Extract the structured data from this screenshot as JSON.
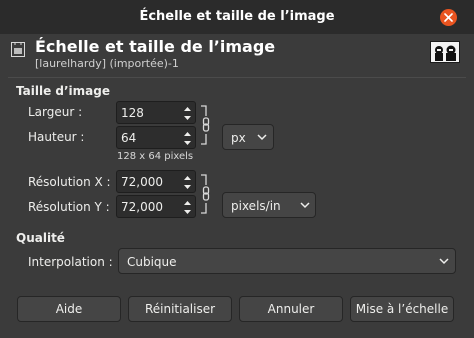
{
  "window": {
    "title": "Échelle et taille de l’image"
  },
  "header": {
    "title": "Échelle et taille de l’image",
    "subtitle": "[laurelhardy] (importée)-1",
    "icon": "scale-image-icon",
    "thumbnail": "image-thumbnail"
  },
  "image_size": {
    "section_label": "Taille d’image",
    "width_label": "Largeur :",
    "width_value": "128",
    "height_label": "Hauteur :",
    "height_value": "64",
    "unit": "px",
    "pixel_info": "128 x 64 pixels",
    "xres_label": "Résolution X :",
    "xres_value": "72,000",
    "yres_label": "Résolution Y :",
    "yres_value": "72,000",
    "res_unit": "pixels/in"
  },
  "quality": {
    "section_label": "Qualité",
    "interp_label": "Interpolation :",
    "interp_value": "Cubique"
  },
  "buttons": {
    "help": "Aide",
    "reset": "Réinitialiser",
    "cancel": "Annuler",
    "scale": "Mise à l’échelle"
  },
  "colors": {
    "accent": "#e95420",
    "background": "#3b3b3b",
    "titlebar": "#2b2b2b"
  }
}
